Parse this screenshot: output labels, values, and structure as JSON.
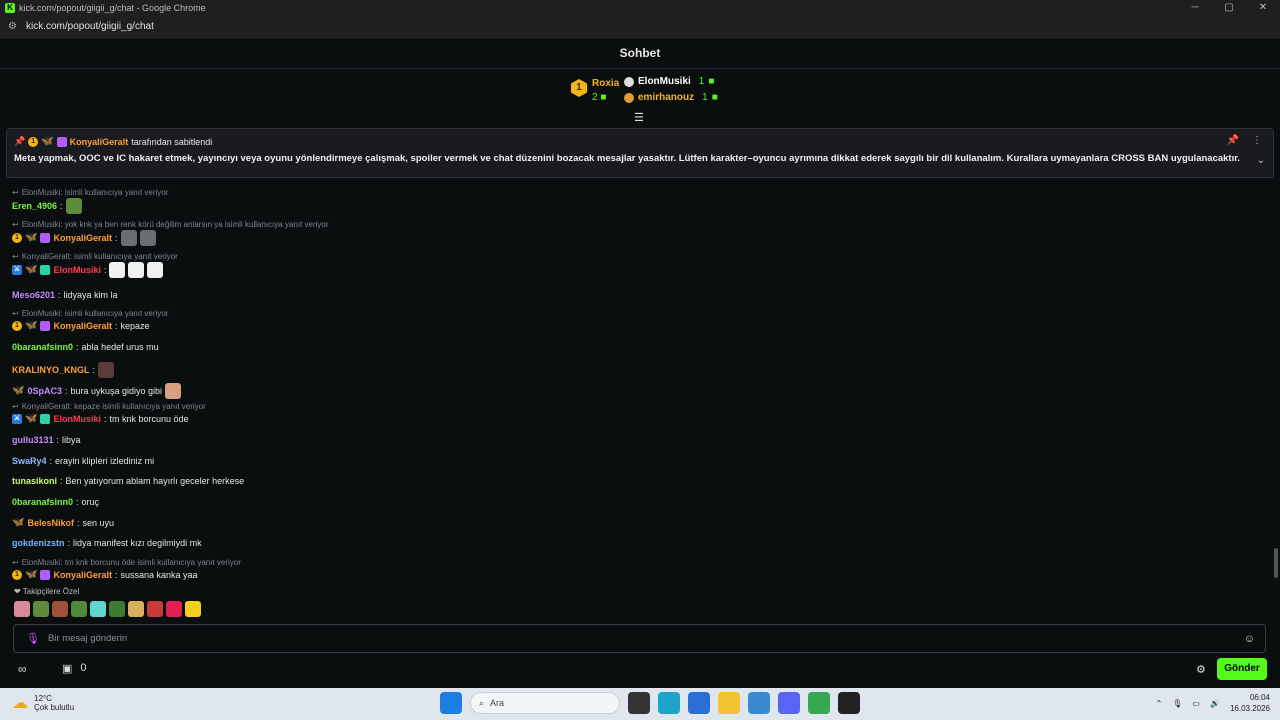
{
  "browser": {
    "window_title": "kick.com/popout/giigii_g/chat - Google Chrome",
    "url": "kick.com/popout/giigii_g/chat",
    "controls": [
      "─",
      "▢",
      "✕"
    ]
  },
  "chat": {
    "title": "Sohbet",
    "leaderboard": {
      "top": {
        "rank": "1",
        "name": "Roxia",
        "count": "2"
      },
      "others": [
        {
          "name": "ElonMusiki",
          "count": "1"
        },
        {
          "name": "emirhanouz",
          "count": "1"
        }
      ]
    },
    "pinned": {
      "author": "KonyaliGeralt",
      "suffix": "tarafından sabitlendi",
      "message": "Meta yapmak, OOC ve IC hakaret etmek, yayıncıyı veya oyunu yönlendirmeye çalışmak, spoiler vermek ve chat düzenini bozacak mesajlar yasaktır. Lütfen karakter–oyuncu ayrımına dikkat ederek saygılı bir dil kullanalım. Kurallara uymayanlara CROSS BAN uygulanacaktır."
    },
    "messages": [
      {
        "reply": "ElonMusiki:  isimli kullanıcıya yanıt veriyor",
        "user": "Eren_4906",
        "color": "#7bf24b",
        "text": ""
      },
      {
        "reply": "ElonMusiki: yok knk ya ben renk körü değilim anlarsın ya isimli kullanıcıya yanıt veriyor",
        "user": "KonyaliGeralt",
        "color": "#ff9e3d",
        "text": ""
      },
      {
        "reply": "KonyaliGeralt:  isimli kullanıcıya yanıt veriyor",
        "user": "ElonMusiki",
        "color": "#ff3b4f",
        "text": ""
      },
      {
        "reply": "",
        "user": "Meso6201",
        "color": "#c58cff",
        "text": "lidyaya kim la"
      },
      {
        "reply": "ElonMusiki:  isimli kullanıcıya yanıt veriyor",
        "user": "KonyaliGeralt",
        "color": "#ff9e3d",
        "text": "kepaze"
      },
      {
        "reply": "",
        "user": "0baranafsinn0",
        "color": "#7bf24b",
        "text": "abla hedef urus mu"
      },
      {
        "reply": "",
        "user": "KRALINYO_KNGL",
        "color": "#ff9e3d",
        "text": ""
      },
      {
        "reply": "",
        "user": "0SpAC3",
        "color": "#c58cff",
        "text": "bura uykuşa gidiyo gibi"
      },
      {
        "reply": "KonyaliGeralt: kepaze isimli kullanıcıya yanıt veriyor",
        "user": "ElonMusiki",
        "color": "#ff3b4f",
        "text": "tm knk borcunu öde"
      },
      {
        "reply": "",
        "user": "gullu3131",
        "color": "#c58cff",
        "text": "libya"
      },
      {
        "reply": "",
        "user": "SwaRy4",
        "color": "#8fb8ff",
        "text": "erayin klipleri izlediniz mi"
      },
      {
        "reply": "",
        "user": "tunasikoni",
        "color": "#c6ff5c",
        "text": "Ben yatıyorum ablam hayırlı geceler herkese"
      },
      {
        "reply": "",
        "user": "0baranafsinn0",
        "color": "#7bf24b",
        "text": "oruç"
      },
      {
        "reply": "",
        "user": "BelesNikof",
        "color": "#ff9e3d",
        "text": "sen uyu"
      },
      {
        "reply": "",
        "user": "gokdenizstn",
        "color": "#6fb6ff",
        "text": "lidya manifest kızı degilmiydi mk"
      },
      {
        "reply": "ElonMusiki: tm knk borcunu öde isimli kullanıcıya yanıt veriyor",
        "user": "KonyaliGeralt",
        "color": "#ff9e3d",
        "text": "sussana kanka yaa"
      }
    ],
    "followers_label": "Takipçilere Özel",
    "input_placeholder": "Bir mesaj gönderin",
    "store_count": "0",
    "send_label": "Gönder"
  },
  "taskbar": {
    "temperature": "12°C",
    "weather": "Çok bulutlu",
    "search_placeholder": "Ara",
    "time": "06:04",
    "date": "16.03.2026"
  },
  "colors": {
    "accent": "#53fc18",
    "background": "#0b0e0f",
    "gold": "#f2b418"
  }
}
